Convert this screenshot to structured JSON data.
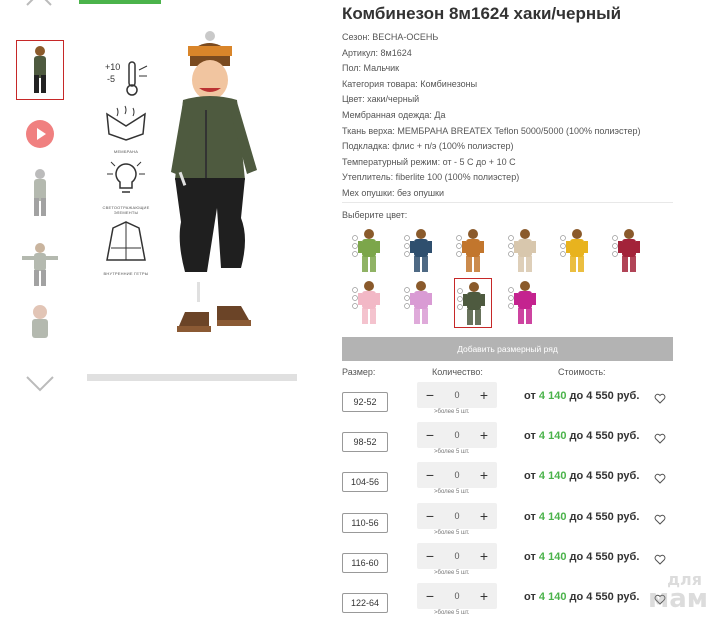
{
  "product": {
    "title": "Комбинезон 8м1624 хаки/черный",
    "properties": [
      "Сезон: ВЕСНА-ОСЕНЬ",
      "Артикул: 8м1624",
      "Пол: Мальчик",
      "Категория товара: Комбинезоны",
      "Цвет: хаки/черный",
      "Мембранная одежда: Да",
      "Ткань верха: МЕМБРАНА BREATEX Teflon 5000/5000 (100% полиэстер)",
      "Подкладка: флис + п/э (100% полиэстер)",
      "Температурный режим: от - 5 С до + 10 С",
      "Утеплитель: fiberlite 100 (100% полиэстер)",
      "Мех опушки: без опушки"
    ]
  },
  "features": [
    {
      "icon": "thermometer-icon",
      "caption": "+10 -5"
    },
    {
      "icon": "membrane-icon",
      "caption": "МЕМБРАНА"
    },
    {
      "icon": "reflective-lamp-icon",
      "caption": "СВЕТООТРАЖАЮЩИЕ ЭЛЕМЕНТЫ"
    },
    {
      "icon": "inner-cuffs-icon",
      "caption": "ВНУТРЕННИЕ ГЕТРЫ"
    }
  ],
  "color_selector": {
    "label": "Выберите цвет:",
    "colors": [
      {
        "hex": "#7ca64a"
      },
      {
        "hex": "#2f4f6e"
      },
      {
        "hex": "#c2762d"
      },
      {
        "hex": "#d8c7ad"
      },
      {
        "hex": "#e8b31e"
      },
      {
        "hex": "#a3233a"
      },
      {
        "hex": "#f2b8c6"
      },
      {
        "hex": "#d99bd4"
      },
      {
        "hex": "#4e5a3f"
      },
      {
        "hex": "#c4238f"
      }
    ],
    "selected_index": 8
  },
  "add_row_label": "Добавить размерный ряд",
  "columns": {
    "size": "Размер:",
    "quantity": "Количество:",
    "price": "Стоимость:"
  },
  "sizes": [
    {
      "size": "92-52",
      "qty": "0",
      "stock": ">более 5 шт.",
      "from": "от",
      "price_low": "4 140",
      "to": "до 4 550 руб."
    },
    {
      "size": "98-52",
      "qty": "0",
      "stock": ">более 5 шт.",
      "from": "от",
      "price_low": "4 140",
      "to": "до 4 550 руб."
    },
    {
      "size": "104-56",
      "qty": "0",
      "stock": ">более 5 шт.",
      "from": "от",
      "price_low": "4 140",
      "to": "до 4 550 руб."
    },
    {
      "size": "110-56",
      "qty": "0",
      "stock": ">более 5 шт.",
      "from": "от",
      "price_low": "4 140",
      "to": "до 4 550 руб."
    },
    {
      "size": "116-60",
      "qty": "0",
      "stock": ">более 5 шт.",
      "from": "от",
      "price_low": "4 140",
      "to": "до 4 550 руб."
    },
    {
      "size": "122-64",
      "qty": "0",
      "stock": ">более 5 шт.",
      "from": "от",
      "price_low": "4 140",
      "to": "до 4 550 руб."
    }
  ],
  "stepper_minus": "−",
  "stepper_plus": "+",
  "watermark": {
    "line1": "для",
    "line2": "мам"
  },
  "colors": {
    "accent_green": "#4bb34b",
    "active_border": "#c62828",
    "button_gray": "#b3b3b3"
  }
}
